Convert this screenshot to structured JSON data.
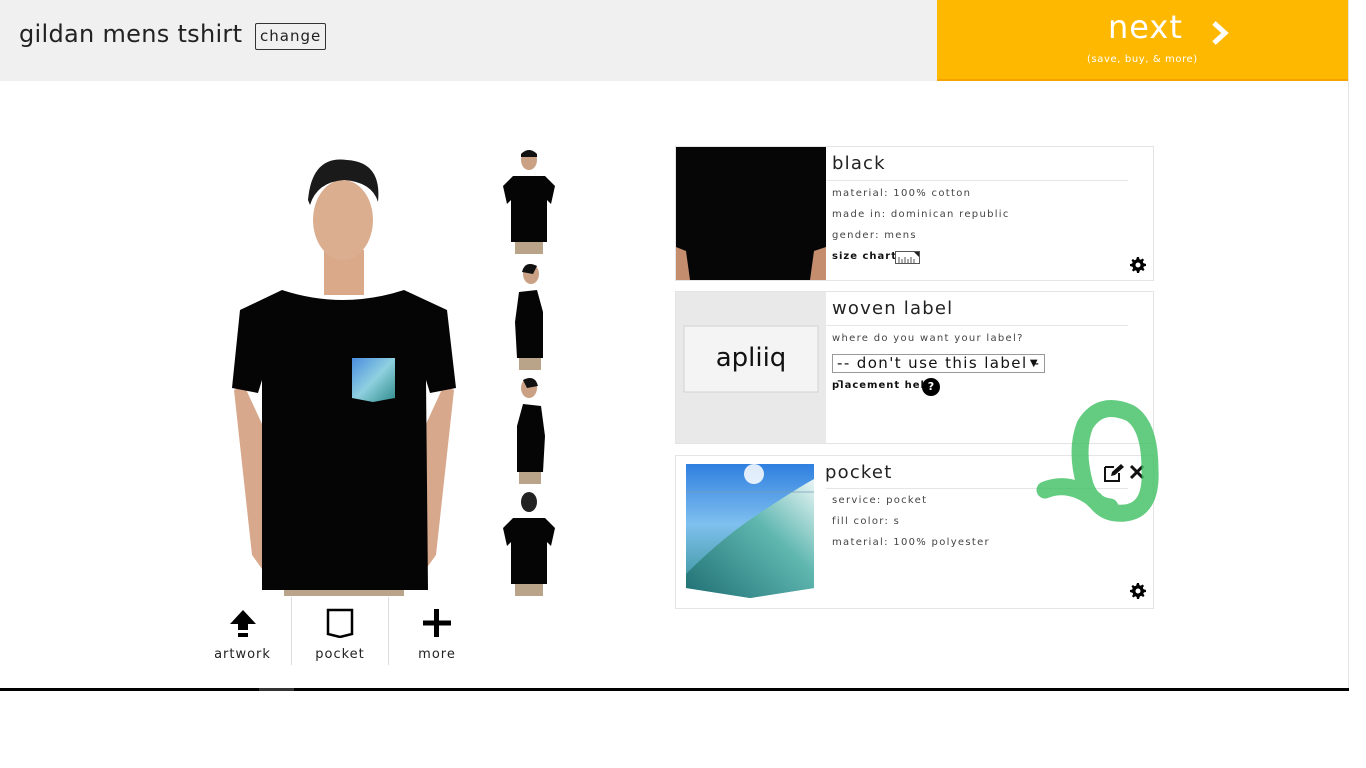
{
  "header": {
    "product_title": "gildan mens tshirt",
    "change_label": "change",
    "next_label": "next",
    "next_sublabel": "(save, buy, & more)",
    "accent_color": "#ffb800"
  },
  "preview": {
    "thumbnails": [
      "front view",
      "right side view",
      "left side view",
      "back view"
    ],
    "tools": [
      {
        "label": "artwork",
        "icon": "upload-icon"
      },
      {
        "label": "pocket",
        "icon": "pocket-icon"
      },
      {
        "label": "more",
        "icon": "plus-icon"
      }
    ]
  },
  "cards": {
    "shirt": {
      "title": "black",
      "material": "material: 100% cotton",
      "made_in": "made in: dominican republic",
      "gender": "gender: mens",
      "size_chart_label": "size chart:"
    },
    "label": {
      "title": "woven label",
      "question": "where do you want your label?",
      "selected_option": "-- don't use this label --",
      "placement_help": "placement help",
      "help_icon": "?",
      "logo_text": "apliiq"
    },
    "pocket": {
      "title": "pocket",
      "service": "service: pocket",
      "fill_color": "fill color: s",
      "material": "material: 100% polyester"
    }
  }
}
